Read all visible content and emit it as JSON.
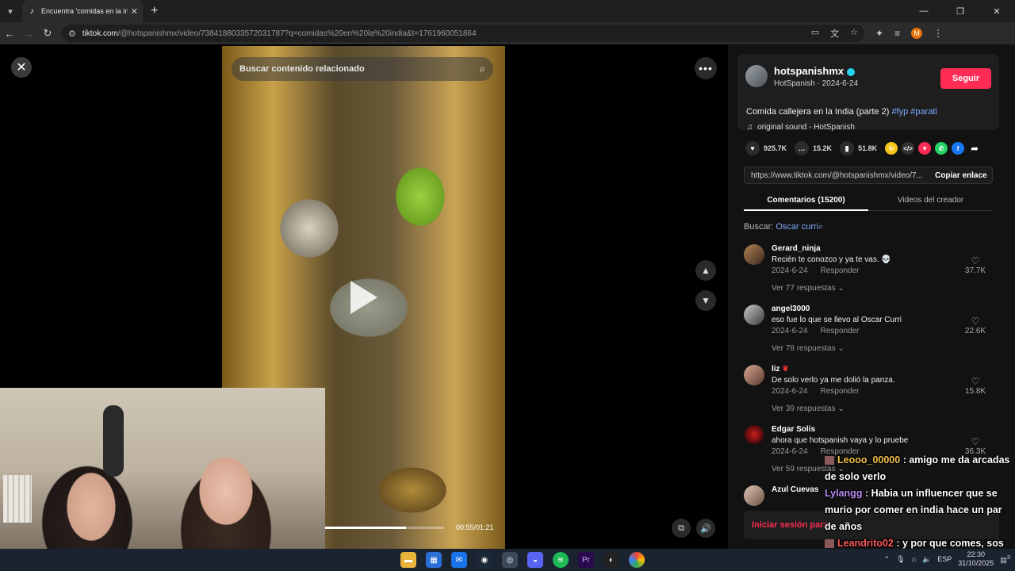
{
  "browser": {
    "tab_title": "Encuentra 'comidas en la india'",
    "url_host": "tiktok.com",
    "url_path": "/@hotspanishmx/video/7384188033572031787?q=comidas%20en%20la%20india&t=1761960051864"
  },
  "video": {
    "search_placeholder": "Buscar contenido relacionado",
    "time": "00:55/01:21",
    "progress": 0.68
  },
  "post": {
    "username": "hotspanishmx",
    "subline": "HotSpanish · 2024-6-24",
    "follow_label": "Seguir",
    "caption": "Comida callejera en la India (parte 2)",
    "tag1": "#fyp",
    "tag2": "#parati",
    "sound": "original sound - HotSpanish",
    "likes": "925.7K",
    "comments_count": "15.2K",
    "saves": "51.8K",
    "link": "https://www.tiktok.com/@hotspanishmx/video/7...",
    "copy_label": "Copiar enlace"
  },
  "tabs": {
    "comments": "Comentarios (15200)",
    "creator": "Videos del creador"
  },
  "search": {
    "label": "Buscar:",
    "term": "Oscar curri"
  },
  "comments": [
    {
      "user": "Gerard_ninja",
      "text": "Recién te conozco y ya te vas. 💀",
      "date": "2024-6-24",
      "reply": "Responder",
      "replies": "Ver 77 respuestas",
      "likes": "37.7K"
    },
    {
      "user": "angel3000",
      "text": "eso fue lo que se llevo al Oscar Curri",
      "date": "2024-6-24",
      "reply": "Responder",
      "replies": "Ver 78 respuestas",
      "likes": "22.6K"
    },
    {
      "user": "liz",
      "text": "De solo verlo ya me dolió la panza.",
      "date": "2024-6-24",
      "reply": "Responder",
      "replies": "Ver 39 respuestas",
      "likes": "15.8K"
    },
    {
      "user": "Edgar Solis",
      "text": "ahora que hotspanish vaya y lo pruebe",
      "date": "2024-6-24",
      "reply": "Responder",
      "replies": "Ver 59 respuestas",
      "likes": "36.3K"
    },
    {
      "user": "Azul Cuevas",
      "text": "",
      "date": "",
      "reply": "",
      "replies": "",
      "likes": ""
    }
  ],
  "login": "Iniciar sesión para",
  "chat": [
    {
      "name": "Leooo_00000",
      "text": "amigo me da arcadas de solo verlo"
    },
    {
      "name": "Lylangg",
      "text": "Habia un influencer que se murio por comer en india hace un par de años"
    },
    {
      "name": "Leandrito02",
      "text": "y por que comes, sos tonto?"
    }
  ],
  "taskbar": {
    "lang": "ESP",
    "time": "22:30",
    "date": "31/10/2025",
    "notif": "3"
  },
  "colors": {
    "accent": "#fe2c55",
    "link": "#7ca9ff"
  }
}
